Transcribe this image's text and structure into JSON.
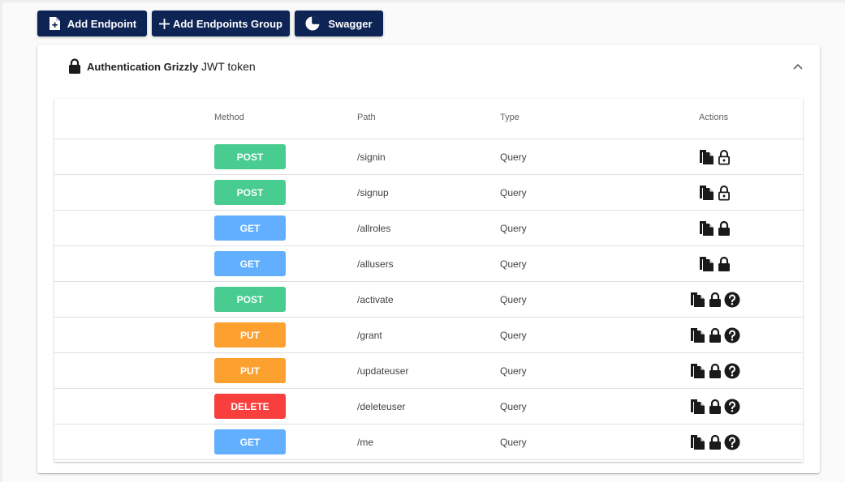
{
  "toolbar": {
    "add_endpoint": "Add Endpoint",
    "add_group": "Add Endpoints Group",
    "swagger": "Swagger"
  },
  "group": {
    "title": "Authentication Grizzly",
    "subtitle": "JWT token",
    "expanded": true
  },
  "table": {
    "headers": {
      "method": "Method",
      "path": "Path",
      "type": "Type",
      "actions": "Actions"
    },
    "rows": [
      {
        "method": "POST",
        "path": "/signin",
        "type": "Query",
        "secured": false,
        "help": false
      },
      {
        "method": "POST",
        "path": "/signup",
        "type": "Query",
        "secured": false,
        "help": false
      },
      {
        "method": "GET",
        "path": "/allroles",
        "type": "Query",
        "secured": true,
        "help": false
      },
      {
        "method": "GET",
        "path": "/allusers",
        "type": "Query",
        "secured": true,
        "help": false
      },
      {
        "method": "POST",
        "path": "/activate",
        "type": "Query",
        "secured": true,
        "help": true
      },
      {
        "method": "PUT",
        "path": "/grant",
        "type": "Query",
        "secured": true,
        "help": true
      },
      {
        "method": "PUT",
        "path": "/updateuser",
        "type": "Query",
        "secured": true,
        "help": true
      },
      {
        "method": "DELETE",
        "path": "/deleteuser",
        "type": "Query",
        "secured": true,
        "help": true
      },
      {
        "method": "GET",
        "path": "/me",
        "type": "Query",
        "secured": true,
        "help": true
      }
    ]
  },
  "colors": {
    "primary": "#0d2455",
    "POST": "#49cc90",
    "GET": "#61affe",
    "PUT": "#fca130",
    "DELETE": "#f93e3e"
  },
  "icons": {
    "copy": "copy-icon",
    "lock_closed": "lock-icon",
    "lock_open": "lock-open-icon",
    "help": "help-icon",
    "chevron": "chevron-up-icon"
  }
}
